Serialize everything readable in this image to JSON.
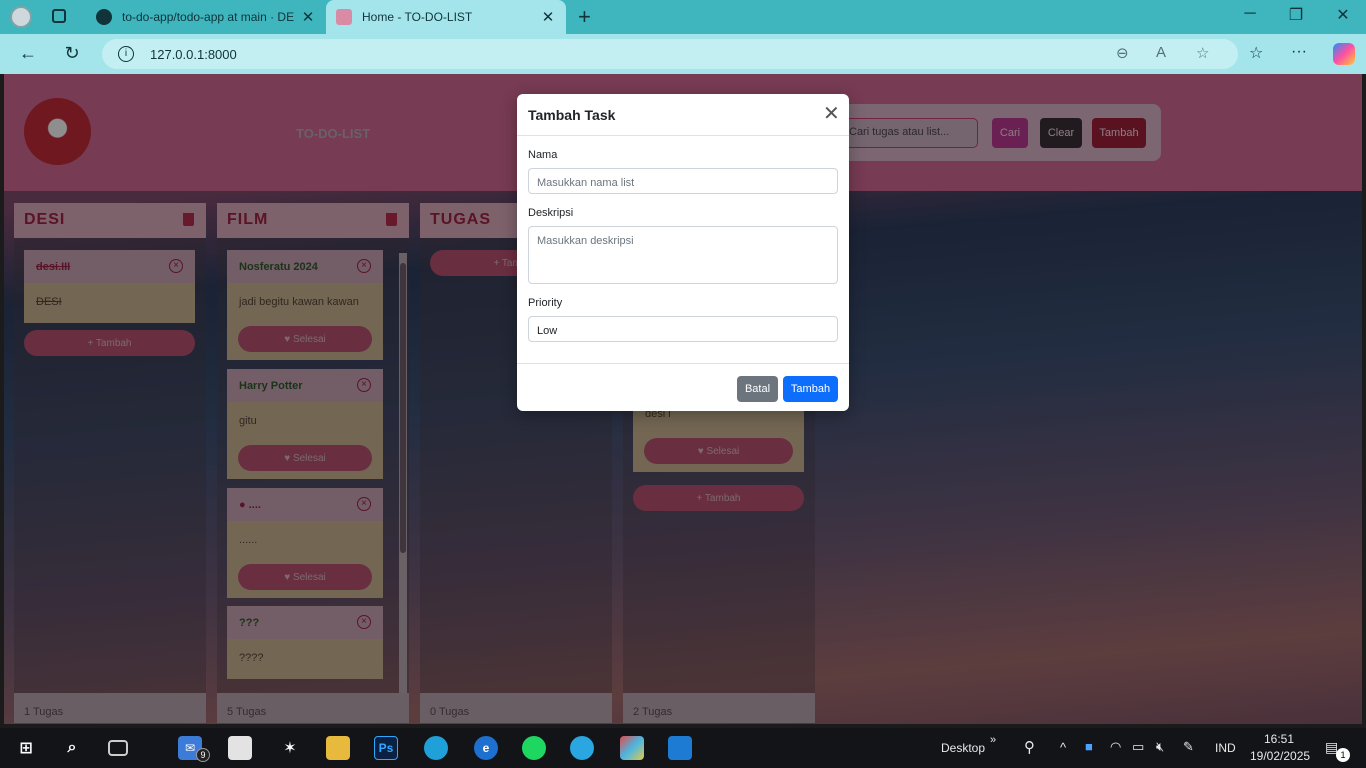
{
  "browser": {
    "tabs": [
      {
        "title": "to-do-app/todo-app at main · DE",
        "close": "✕"
      },
      {
        "title": "Home - TO-DO-LIST",
        "close": "✕"
      }
    ],
    "new_tab": "+",
    "window_controls": {
      "minimize": "─",
      "restore": "❐",
      "close": "✕"
    },
    "nav": {
      "back": "←",
      "refresh": "↻"
    },
    "url": "127.0.0.1:8000",
    "url_icons": {
      "zoom": "⊖",
      "read_aloud": "A",
      "favorite": "☆"
    },
    "toolbar_icons": {
      "favorites": "☆",
      "menu": "···"
    }
  },
  "app": {
    "title": "TO-DO-LIST",
    "search_placeholder": "Cari tugas atau list...",
    "search_button": "Cari",
    "clear_button": "Clear",
    "add_button": "Tambah"
  },
  "columns": [
    {
      "title": "DESI",
      "count": "1 Tugas",
      "cards": [
        {
          "title": "desi.III",
          "desc": "DESI"
        }
      ],
      "add": "+ Tambah"
    },
    {
      "title": "FILM",
      "count": "5 Tugas",
      "cards": [
        {
          "title": "Nosferatu 2024",
          "desc": "jadi begitu kawan kawan",
          "button": "Selesai"
        },
        {
          "title": "Harry Potter",
          "desc": "gitu",
          "button": "Selesai"
        },
        {
          "title": "....",
          "desc": "......",
          "button": "Selesai"
        },
        {
          "title": "???",
          "desc": "????"
        }
      ]
    },
    {
      "title": "TUGAS",
      "count": "0 Tugas",
      "add": "+ Tambah"
    },
    {
      "title": "",
      "count": "2 Tugas",
      "cards": [
        {
          "desc": "desi i",
          "button": "Selesai"
        }
      ],
      "add": "+ Tambah"
    }
  ],
  "modal": {
    "title": "Tambah Task",
    "close": "✕",
    "nama_label": "Nama",
    "nama_placeholder": "Masukkan nama list",
    "deskripsi_label": "Deskripsi",
    "deskripsi_placeholder": "Masukkan deskripsi",
    "priority_label": "Priority",
    "priority_value": "Low",
    "cancel": "Batal",
    "submit": "Tambah"
  },
  "taskbar": {
    "mail_badge": "9",
    "ps_label": "Ps",
    "desktop_label": "Desktop",
    "chevron": "»",
    "up_arrow": "^",
    "lang": "IND",
    "time": "16:51",
    "date": "19/02/2025",
    "notif_badge": "1"
  },
  "colors": {
    "tabbar": "#3fb5bd",
    "addressbar": "#a3e5ea",
    "header": "#cd6690",
    "modal_primary": "#0d6efd",
    "modal_secondary": "#6c757d"
  }
}
